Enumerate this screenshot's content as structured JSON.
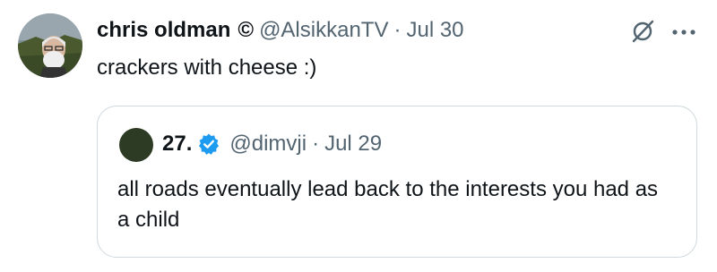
{
  "tweet": {
    "author": {
      "name": "chris oldman",
      "badge": "©",
      "handle": "@AlsikkanTV",
      "avatar_icon": "avatar-photo-man-with-beard"
    },
    "separator": "·",
    "date": "Jul 30",
    "text": "crackers with cheese :)",
    "actions": {
      "grok_icon": "grok-icon",
      "more_icon": "more-dots-icon"
    }
  },
  "quoted_tweet": {
    "author": {
      "name": "27.",
      "handle": "@dimvji",
      "verified_icon": "verified-badge-icon",
      "avatar_color": "#2d3a24"
    },
    "separator": "·",
    "date": "Jul 29",
    "text": "all roads eventually lead back to the interests you had as a child"
  },
  "colors": {
    "text_primary": "#0f1419",
    "text_muted": "#536471",
    "border": "#cfd9de",
    "verified": "#1d9bf0"
  }
}
